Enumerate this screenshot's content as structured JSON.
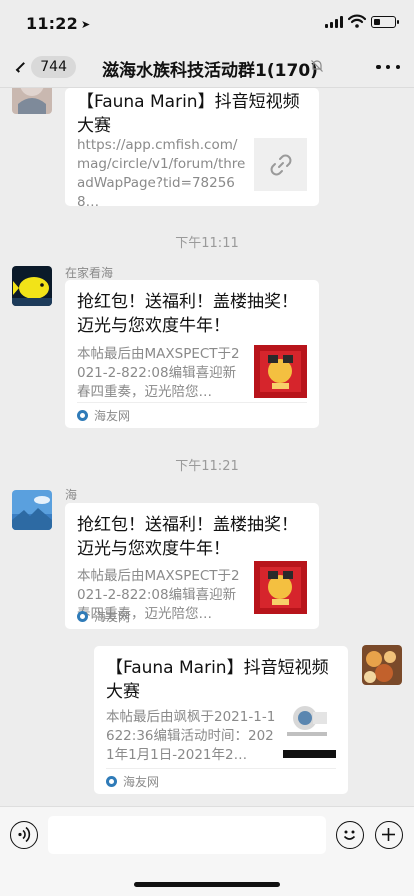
{
  "status": {
    "time": "11:22",
    "battery_level": 0.3
  },
  "nav": {
    "back_count": "744",
    "title": "滋海水族科技活动群1(170)"
  },
  "messages": [
    {
      "title": "【Fauna Marin】抖音短视频大赛",
      "desc": "https://app.cmfish.com/mag/circle/v1/forum/threadWapPage?tid=782568…",
      "thumb_icon": "link-icon"
    },
    {
      "time": "下午11:11",
      "sender": "在家看海",
      "title": "抢红包！送福利！盖楼抽奖！迈光与您欢度牛年！",
      "desc": "本帖最后由MAXSPECT于2021-2-822:08编辑喜迎新春四重奏，迈光陪您…",
      "source": "海友网"
    },
    {
      "time": "下午11:21",
      "sender": "海",
      "title": "抢红包！送福利！盖楼抽奖！迈光与您欢度牛年！",
      "desc": "本帖最后由MAXSPECT于2021-2-822:08编辑喜迎新春四重奏，迈光陪您…",
      "source": "海友网"
    },
    {
      "title": "【Fauna Marin】抖音短视频大赛",
      "desc": "本帖最后由飒枫于2021-1-1622:36编辑活动时间：2021年1月1日-2021年2…",
      "source": "海友网"
    }
  ],
  "colors": {
    "background": "#ededed",
    "card": "#ffffff",
    "muted_text": "#8a8a8a"
  }
}
